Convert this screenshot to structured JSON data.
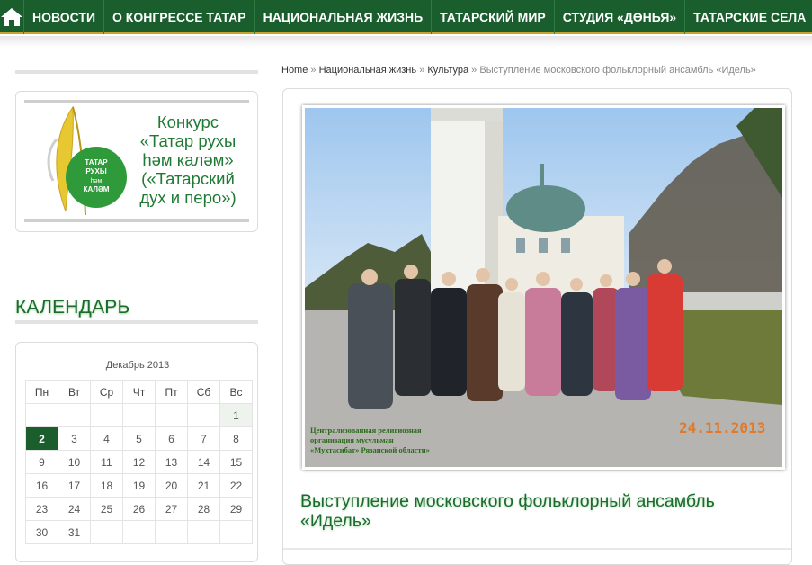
{
  "nav": {
    "items": [
      "НОВОСТИ",
      "О КОНГРЕССЕ ТАТАР",
      "НАЦИОНАЛЬНАЯ ЖИЗНЬ",
      "ТАТАРСКИЙ МИР",
      "СТУДИЯ «ДӨНЬЯ»",
      "ТАТАРСКИЕ СЕЛА"
    ],
    "home_icon": "home-icon"
  },
  "banner": {
    "line1": "Конкурс",
    "line2": "«Татар рухы",
    "line3": "һәм каләм»",
    "line4": "(«Татарский",
    "line5": "дух и перо»)",
    "logo_text": "ТАТАР РУХЫ һәм КАЛӘМ"
  },
  "calendar": {
    "title": "КАЛЕНДАРЬ",
    "month": "Декабрь 2013",
    "weekdays": [
      "Пн",
      "Вт",
      "Ср",
      "Чт",
      "Пт",
      "Сб",
      "Вс"
    ],
    "weeks": [
      [
        "",
        "",
        "",
        "",
        "",
        "",
        "1"
      ],
      [
        "2",
        "3",
        "4",
        "5",
        "6",
        "7",
        "8"
      ],
      [
        "9",
        "10",
        "11",
        "12",
        "13",
        "14",
        "15"
      ],
      [
        "16",
        "17",
        "18",
        "19",
        "20",
        "21",
        "22"
      ],
      [
        "23",
        "24",
        "25",
        "26",
        "27",
        "28",
        "29"
      ],
      [
        "30",
        "31",
        "",
        "",
        "",
        "",
        ""
      ]
    ],
    "today": "2"
  },
  "breadcrumb": {
    "home": "Home",
    "sep": "»",
    "level1": "Национальная жизнь",
    "level2": "Культура",
    "current": "Выступление московского фольклорный ансамбль «Идель»"
  },
  "article": {
    "title": "Выступление московского фольклорный ансамбль «Идель»",
    "photo_caption": "Централизованная религиозная\nорганизация мусульман\n«Мухтасибат» Рязанской области»",
    "photo_date": "24.11.2013"
  },
  "colors": {
    "nav_bg": "#1b5e2e",
    "accent_green": "#1b6b2e",
    "gold_line": "#c9a227"
  }
}
